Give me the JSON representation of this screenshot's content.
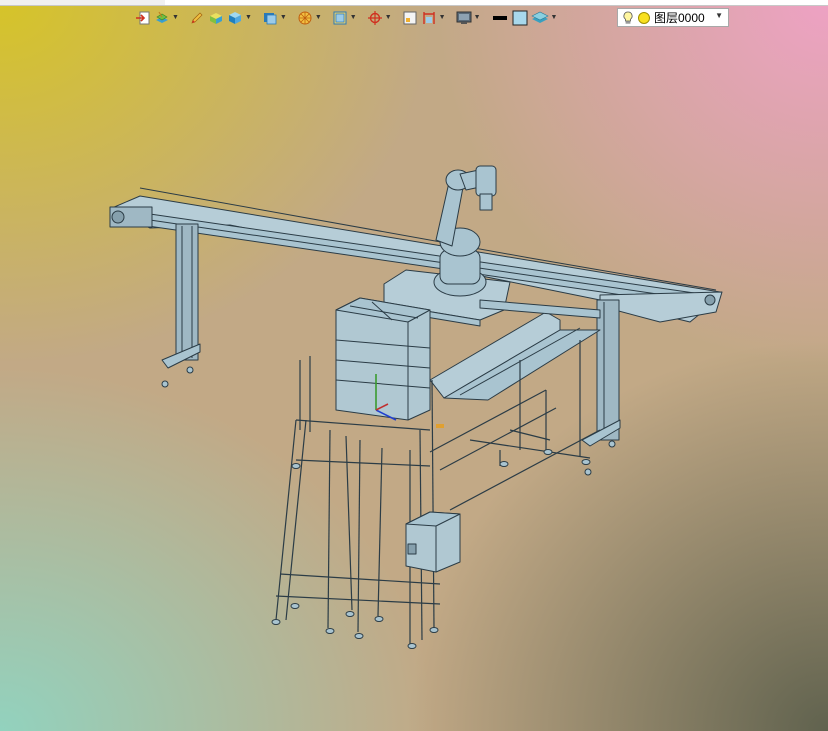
{
  "layer": {
    "name": "图层0000"
  },
  "toolbar_icons": [
    "import-icon",
    "layers-icon",
    "pen-icon",
    "box-icon",
    "cube-icon",
    "solid-icon",
    "shading-icon",
    "viewport-icon",
    "snap-icon",
    "sheet-icon",
    "dimension-icon",
    "monitor-icon",
    "line-color-icon",
    "fill-color-icon",
    "layer-stack-icon"
  ],
  "colors": {
    "model_fill": "#a9c4d0",
    "model_edge": "#2b3c46",
    "gradient_top_left": "#d6c428",
    "gradient_top_right": "#eea2c4",
    "gradient_bottom_left": "#92d2be",
    "gradient_bottom_right": "#60624e"
  }
}
